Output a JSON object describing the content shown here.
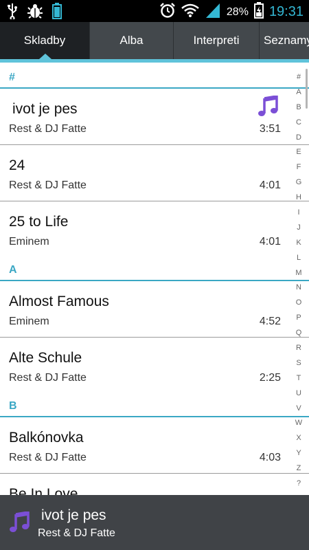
{
  "status_bar": {
    "battery_percent": "28%",
    "time": "19:31",
    "icons": [
      "usb-icon",
      "debug-icon",
      "battery-notify-icon",
      "alarm-icon",
      "wifi-icon",
      "signal-icon",
      "battery-icon"
    ]
  },
  "tabs": [
    {
      "label": "Skladby",
      "active": true
    },
    {
      "label": "Alba",
      "active": false
    },
    {
      "label": "Interpreti",
      "active": false
    },
    {
      "label": "Seznamy",
      "active": false
    }
  ],
  "sections": [
    {
      "header": "#",
      "songs": [
        {
          "title": "ivot je pes",
          "artist": "Rest & DJ Fatte",
          "duration": "3:51",
          "playing": true
        },
        {
          "title": "24",
          "artist": "Rest & DJ Fatte",
          "duration": "4:01",
          "playing": false
        },
        {
          "title": "25 to Life",
          "artist": "Eminem",
          "duration": "4:01",
          "playing": false
        }
      ]
    },
    {
      "header": "A",
      "songs": [
        {
          "title": "Almost Famous",
          "artist": "Eminem",
          "duration": "4:52",
          "playing": false
        },
        {
          "title": "Alte Schule",
          "artist": "Rest & DJ Fatte",
          "duration": "2:25",
          "playing": false
        }
      ]
    },
    {
      "header": "B",
      "songs": [
        {
          "title": "Balkónovka",
          "artist": "Rest & DJ Fatte",
          "duration": "4:03",
          "playing": false
        },
        {
          "title": "Be In Love",
          "artist": "",
          "duration": "",
          "playing": false
        }
      ]
    }
  ],
  "alphabet_index": [
    "#",
    "A",
    "B",
    "C",
    "D",
    "E",
    "F",
    "G",
    "H",
    "I",
    "J",
    "K",
    "L",
    "M",
    "N",
    "O",
    "P",
    "Q",
    "R",
    "S",
    "T",
    "U",
    "V",
    "W",
    "X",
    "Y",
    "Z",
    "?"
  ],
  "now_playing": {
    "title": "ivot je pes",
    "artist": "Rest & DJ Fatte",
    "icon": "music-note-icon"
  },
  "colors": {
    "accent": "#34b8d4",
    "section_header": "#3aa7c4",
    "tab_bg": "#43484c",
    "tab_active_bg": "#1e2124",
    "music_note": "#7b4fd6"
  }
}
